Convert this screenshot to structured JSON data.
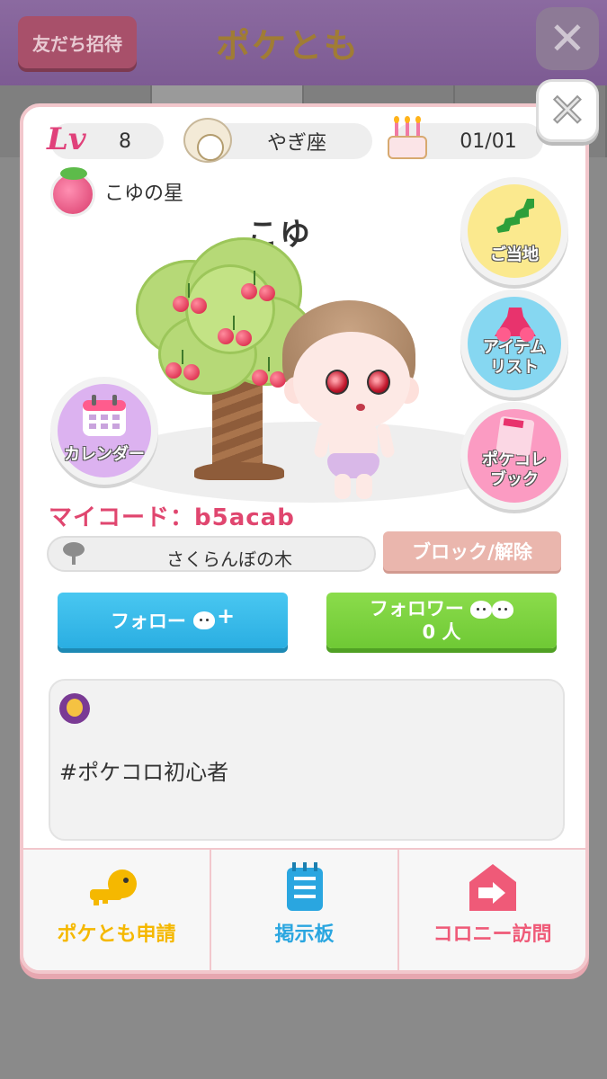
{
  "background": {
    "invite_button": "友だち招待",
    "title": "ポケとも",
    "close_glyph": "✕"
  },
  "profile": {
    "level_badge": "Lv",
    "level": "8",
    "zodiac": "やぎ座",
    "birthday": "01/01",
    "planet_name": "こゆの星",
    "username": "こゆ",
    "my_code": "マイコード：b5acab",
    "tree_name": "さくらんぼの木",
    "bio": "#ポケコロ初心者"
  },
  "side_buttons": {
    "local": "ご当地",
    "item_list_line1": "アイテム",
    "item_list_line2": "リスト",
    "calendar": "カレンダー",
    "pokecolle_line1": "ポケコレ",
    "pokecolle_line2": "ブック"
  },
  "actions": {
    "block": "ブロック/解除",
    "follow": "フォロー",
    "follower": "フォロワー",
    "follower_count": "0 人"
  },
  "bottom_nav": {
    "friend_request": "ポケとも申請",
    "board": "掲示板",
    "colony_visit": "コロニー訪問"
  },
  "colors": {
    "accent_pink": "#e0466f",
    "follow_blue": "#2aaee2",
    "follower_green": "#6fc935",
    "request_yellow": "#f5b800",
    "board_blue": "#2aa6e0",
    "colony_pink": "#ef5a78"
  },
  "icons": [
    "goat-icon",
    "cake-icon",
    "planet-icon",
    "japan-map-icon",
    "dress-icon",
    "calendar-icon",
    "book-icon",
    "tree-icon",
    "key-icon",
    "memo-icon",
    "door-icon"
  ]
}
